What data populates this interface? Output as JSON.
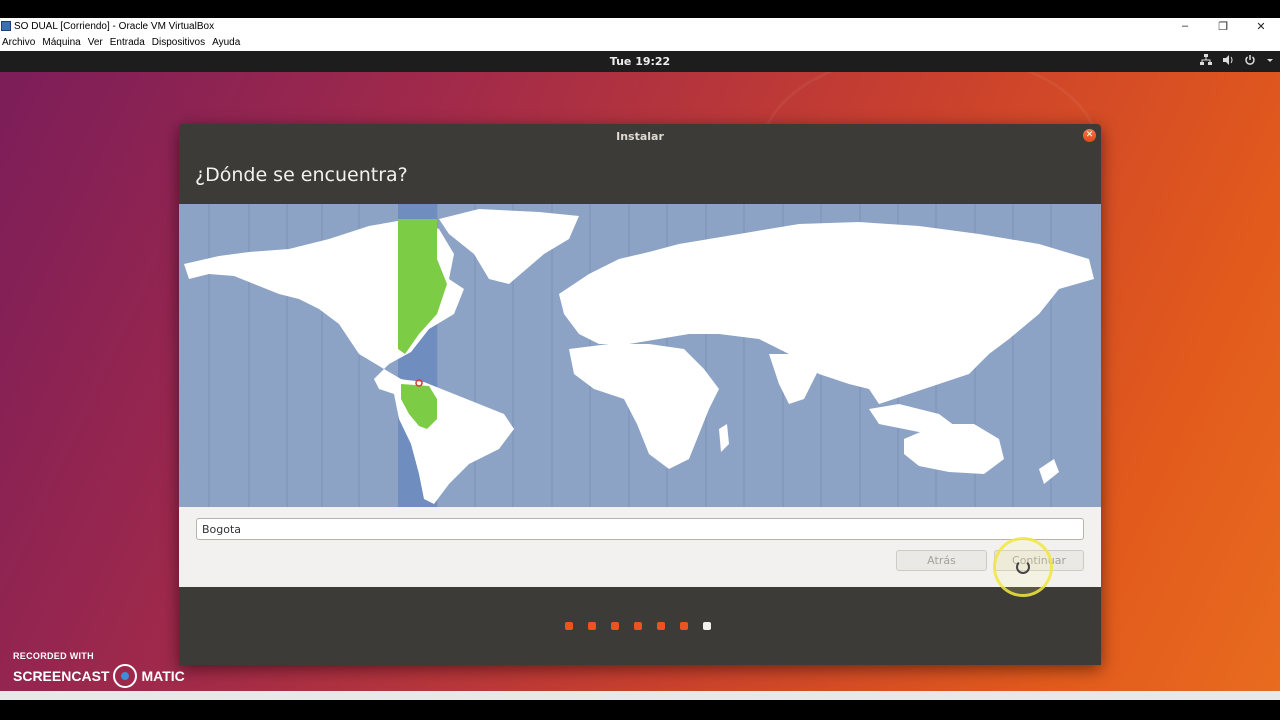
{
  "vbox": {
    "title": "SO DUAL [Corriendo] - Oracle VM VirtualBox",
    "menu": [
      "Archivo",
      "Máquina",
      "Ver",
      "Entrada",
      "Dispositivos",
      "Ayuda"
    ],
    "minimize": "–",
    "maximize": "❐",
    "close": "✕"
  },
  "topbar": {
    "clock": "Tue 19:22",
    "icons": [
      "network-icon",
      "volume-icon",
      "power-icon",
      "chevron-down-icon"
    ]
  },
  "dialog": {
    "title": "Instalar",
    "heading": "¿Dónde se encuentra?",
    "location_value": "Bogota",
    "back_label": "Atrás",
    "continue_label": "Continuar",
    "progress": {
      "total_steps": 7,
      "current_step": 7
    }
  },
  "watermark": {
    "line1": "RECORDED WITH",
    "left": "SCREENCAST",
    "right": "MATIC"
  },
  "colors": {
    "accent": "#e95420",
    "map_ocean": "#8da3c6",
    "timezone_highlight": "#7ccc46",
    "dialog_bg": "#3c3b37"
  }
}
